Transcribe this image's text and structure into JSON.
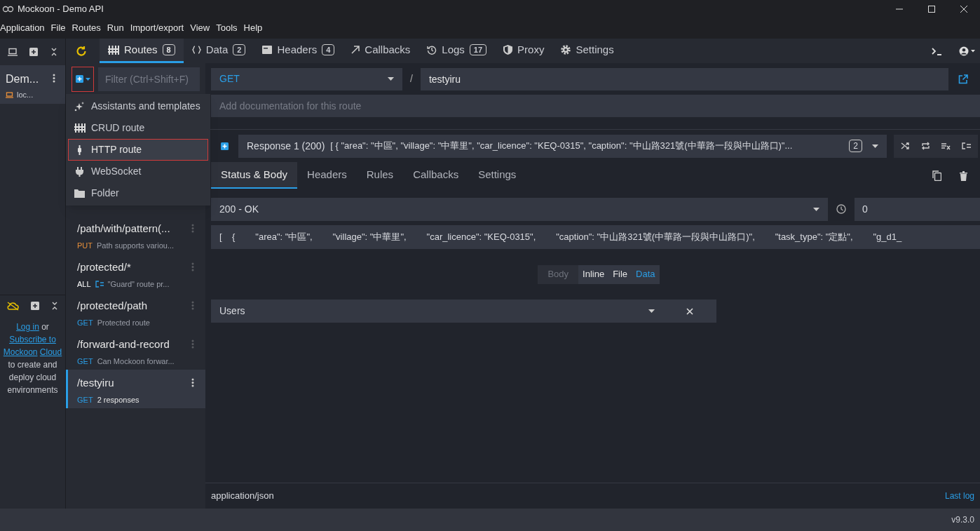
{
  "window": {
    "title": "Mockoon - Demo API"
  },
  "menu": [
    "Application",
    "File",
    "Routes",
    "Run",
    "Import/export",
    "View",
    "Tools",
    "Help"
  ],
  "environments": [
    {
      "name": "Dem...",
      "host": "loc...",
      "selected": true
    }
  ],
  "cloud": {
    "segments": [
      {
        "kind": "link",
        "text": "Log in"
      },
      {
        "kind": "text",
        "text": " or "
      },
      {
        "kind": "link",
        "text": "Subscribe to"
      },
      {
        "kind": "link",
        "text": "Mockoon"
      },
      {
        "kind": "link",
        "text": "Cloud"
      },
      {
        "kind": "text",
        "text": " to create and deploy cloud environments"
      }
    ]
  },
  "tabs": [
    {
      "label": "Routes",
      "count": "8",
      "selected": true
    },
    {
      "label": "Data",
      "count": "2",
      "selected": false
    },
    {
      "label": "Headers",
      "count": "4",
      "selected": false
    },
    {
      "label": "Callbacks",
      "selected": false
    },
    {
      "label": "Logs",
      "count": "17",
      "selected": false
    },
    {
      "label": "Proxy",
      "selected": false
    },
    {
      "label": "Settings",
      "selected": false
    }
  ],
  "filter": {
    "placeholder": "Filter (Ctrl+Shift+F)"
  },
  "add_menu": [
    {
      "label": "Assistants and templates",
      "selected": false
    },
    {
      "label": "CRUD route",
      "selected": false
    },
    {
      "label": "HTTP route",
      "selected": true
    },
    {
      "label": "WebSocket",
      "selected": false
    },
    {
      "label": "Folder",
      "selected": false
    }
  ],
  "routes": [
    {
      "path": "/path/with/pattern(...",
      "method": "PUT",
      "color": "#e8903a",
      "description": "Path supports variou...",
      "rules": false,
      "selected": false
    },
    {
      "path": "/protected/*",
      "method": "ALL",
      "color": "#ffffff",
      "description": "\"Guard\" route pr...",
      "rules": true,
      "selected": false
    },
    {
      "path": "/protected/path",
      "method": "GET",
      "color": "#2a9ee6",
      "description": "Protected route",
      "rules": false,
      "selected": false
    },
    {
      "path": "/forward-and-record",
      "method": "GET",
      "color": "#2a9ee6",
      "description": "Can Mockoon forwar...",
      "rules": false,
      "selected": false
    },
    {
      "path": "/testyiru",
      "method": "GET",
      "color": "#2a9ee6",
      "description": "2 responses",
      "rules": false,
      "selected": true
    }
  ],
  "route": {
    "method": "GET",
    "separator": "/",
    "path": "testyiru",
    "documentation_placeholder": "Add documentation for this route"
  },
  "response": {
    "label": "Response 1 (200)",
    "preview": "[ { \"area\": \"中區\", \"village\": \"中華里\", \"car_licence\": \"KEQ-0315\", \"caption\": \"中山路321號(中華路一段與中山路口)\"...",
    "count": "2"
  },
  "response_tabs": [
    {
      "label": "Status & Body",
      "selected": true
    },
    {
      "label": "Headers",
      "selected": false
    },
    {
      "label": "Rules",
      "selected": false
    },
    {
      "label": "Callbacks",
      "selected": false
    },
    {
      "label": "Settings",
      "selected": false
    }
  ],
  "status": "200 - OK",
  "latency": "0",
  "body_preview": "[    {        \"area\": \"中區\",        \"village\": \"中華里\",        \"car_licence\": \"KEQ-0315\",        \"caption\": \"中山路321號(中華路一段與中山路口)\",        \"task_type\": \"定點\",        \"g_d1_",
  "body_source": {
    "label": "Body",
    "options": [
      {
        "label": "Inline",
        "selected": false
      },
      {
        "label": "File",
        "selected": false
      },
      {
        "label": "Data",
        "selected": true
      }
    ]
  },
  "databucket": "Users",
  "footer": {
    "content_type": "application/json",
    "last_log": "Last log"
  },
  "version": "v9.3.0"
}
